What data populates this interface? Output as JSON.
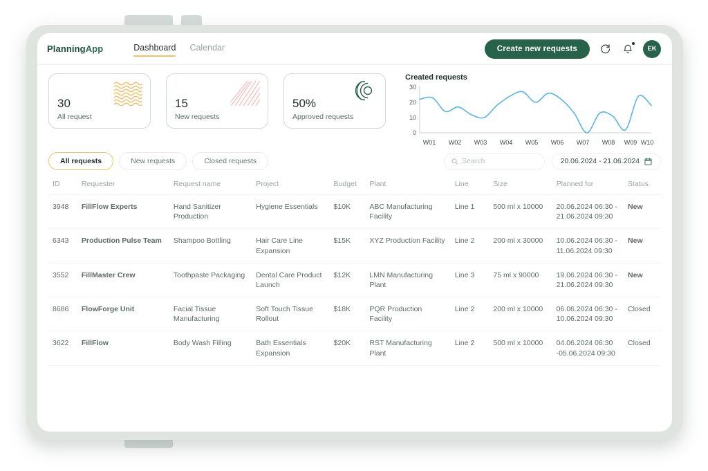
{
  "header": {
    "logo_bold": "Planning",
    "logo_light": "App",
    "nav": [
      {
        "label": "Dashboard",
        "active": true
      },
      {
        "label": "Calendar",
        "active": false
      }
    ],
    "create_button": "Create new requests",
    "refresh_icon": "refresh-icon",
    "bell_icon": "bell-icon",
    "avatar_initials": "EK"
  },
  "stats": [
    {
      "value": "30",
      "label": "All request",
      "deco": "wavy-lines",
      "color": "#f0c36b"
    },
    {
      "value": "15",
      "label": "New requests",
      "deco": "diagonal-stripes",
      "color": "#f2c4c4"
    },
    {
      "value": "50%",
      "label": "Approved requests",
      "deco": "concentric-arcs",
      "color": "#27624b"
    }
  ],
  "chart_data": {
    "type": "line",
    "title": "Created requests",
    "xlabel": "",
    "ylabel": "",
    "ylim": [
      0,
      30
    ],
    "yticks": [
      0,
      10,
      20,
      30
    ],
    "categories": [
      "W01",
      "W02",
      "W03",
      "W04",
      "W05",
      "W06",
      "W07",
      "W08",
      "W09",
      "W10"
    ],
    "series": [
      {
        "name": "Created requests",
        "color": "#5ab4e8",
        "values": [
          22,
          17,
          10,
          24,
          20,
          26,
          0,
          13,
          2,
          24
        ]
      }
    ],
    "points": [
      {
        "x": "W01",
        "y": 22
      },
      {
        "x": "W01+",
        "y": 23
      },
      {
        "x": "W01-W02",
        "y": 14
      },
      {
        "x": "W02",
        "y": 17
      },
      {
        "x": "W02-W03",
        "y": 12
      },
      {
        "x": "W03",
        "y": 10
      },
      {
        "x": "W03-W04",
        "y": 18
      },
      {
        "x": "W04",
        "y": 24
      },
      {
        "x": "W04+",
        "y": 27
      },
      {
        "x": "W05",
        "y": 20
      },
      {
        "x": "W05+",
        "y": 26
      },
      {
        "x": "W06",
        "y": 22
      },
      {
        "x": "W06+",
        "y": 13
      },
      {
        "x": "W07",
        "y": 0
      },
      {
        "x": "W07+",
        "y": 13
      },
      {
        "x": "W08",
        "y": 11
      },
      {
        "x": "W09",
        "y": 2
      },
      {
        "x": "W09+",
        "y": 24
      },
      {
        "x": "W10",
        "y": 18
      }
    ],
    "grid": false,
    "legend": "none"
  },
  "toolbar": {
    "filters": [
      {
        "label": "All requests",
        "active": true
      },
      {
        "label": "New requests",
        "active": false
      },
      {
        "label": "Closed requests",
        "active": false
      }
    ],
    "search_placeholder": "Search",
    "search_value": "",
    "search_icon": "search-icon",
    "date_range": "20.06.2024 - 21.06.2024",
    "calendar_icon": "calendar-icon"
  },
  "table": {
    "columns": [
      "ID",
      "Requester",
      "Request name",
      "Project",
      "Budget",
      "Plant",
      "Line",
      "Size",
      "Planned for",
      "Status"
    ],
    "rows": [
      {
        "id": "3948",
        "requester": "FillFlow Experts",
        "request_name": "Hand Sanitizer Production",
        "project": "Hygiene Essentials",
        "budget": "$10K",
        "plant": "ABC Manufacturing Facility",
        "line": "Line 1",
        "size": "500 ml x 10000",
        "planned_for": "20.06.2024 06:30 - 21.06.2024 09:30",
        "status": "New"
      },
      {
        "id": "6343",
        "requester": "Production Pulse Team",
        "request_name": "Shampoo Bottling",
        "project": "Hair Care Line Expansion",
        "budget": "$15K",
        "plant": "XYZ Production Facility",
        "line": "Line 2",
        "size": "200 ml x 30000",
        "planned_for": "10.06.2024 06:30 - 11.06.2024 09:30",
        "status": "New"
      },
      {
        "id": "3552",
        "requester": "FillMaster Crew",
        "request_name": "Toothpaste Packaging",
        "project": "Dental Care Product Launch",
        "budget": "$12K",
        "plant": "LMN Manufacturing Plant",
        "line": "Line 3",
        "size": "75 ml x 90000",
        "planned_for": "19.06.2024 06:30 - 21.06.2024 09:30",
        "status": "New"
      },
      {
        "id": "8686",
        "requester": "FlowForge Unit",
        "request_name": "Facial Tissue Manufacturing",
        "project": "Soft Touch Tissue Rollout",
        "budget": "$18K",
        "plant": "PQR Production Facility",
        "line": "Line 2",
        "size": "200 ml x 10000",
        "planned_for": "06.06.2024 06:30 - 10.06.2024 09:30",
        "status": "Closed"
      },
      {
        "id": "3622",
        "requester": "FillFlow",
        "request_name": "Body Wash Filling",
        "project": "Bath Essentials Expansion",
        "budget": "$20K",
        "plant": "RST Manufacturing Plant",
        "line": "Line 2",
        "size": "500 ml x 10000",
        "planned_for": "04.06.2024 06:30 -05.06.2024 09:30",
        "status": "Closed"
      }
    ]
  }
}
